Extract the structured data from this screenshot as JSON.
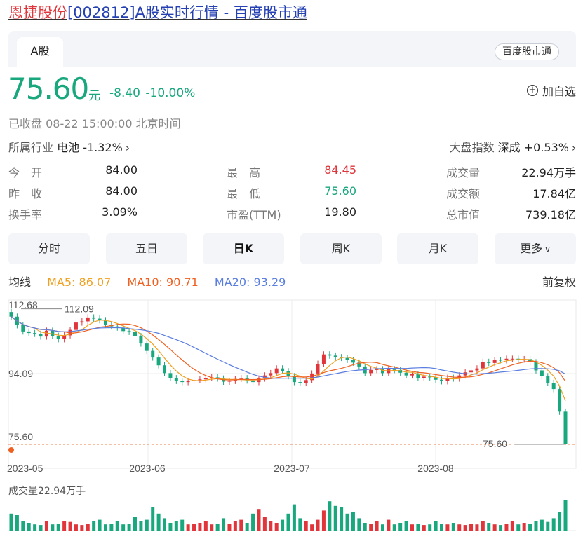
{
  "header": {
    "title_name": "恩捷股份",
    "title_rest": "[002812]A股实时行情 - 百度股市通"
  },
  "tabs": {
    "active": "A股",
    "source_badge": "百度股市通"
  },
  "quote": {
    "price": "75.60",
    "currency": "元",
    "change": "-8.40 -10.00%",
    "add_watch": "加自选",
    "status": "已收盘  08-22 15:00:00  北京时间"
  },
  "industry": {
    "label": "所属行业",
    "value": "电池 -1.32%"
  },
  "market": {
    "label": "大盘指数",
    "value": "深成 +0.53%"
  },
  "stats": {
    "open_label": "今　开",
    "open": "84.00",
    "prev_label": "昨　收",
    "prev": "84.00",
    "turnover_label": "换手率",
    "turnover": "3.09%",
    "high_label": "最　高",
    "high": "84.45",
    "low_label": "最　低",
    "low": "75.60",
    "pe_label": "市盈(TTM)",
    "pe": "19.80",
    "vol_label": "成交量",
    "vol": "22.94万手",
    "amount_label": "成交额",
    "amount": "17.84亿",
    "mcap_label": "总市值",
    "mcap": "739.18亿"
  },
  "period_tabs": [
    "分时",
    "五日",
    "日K",
    "周K",
    "月K",
    "更多"
  ],
  "active_period": "日K",
  "ma": {
    "label": "均线",
    "ma5": "MA5: 86.07",
    "ma10": "MA10: 90.71",
    "ma20": "MA20: 93.29",
    "adjust": "前复权"
  },
  "colors": {
    "up": "#e0353a",
    "down": "#19a77e",
    "ma5": "#f0a020",
    "ma10": "#f06020",
    "ma20": "#5a7ee0"
  },
  "chart_data": {
    "type": "candlestick",
    "y_labels": [
      "112.68",
      "94.09",
      "75.60"
    ],
    "x_labels": [
      "2023-05",
      "2023-06",
      "2023-07",
      "2023-08"
    ],
    "annotations": {
      "max": "112.09",
      "min": "75.60"
    },
    "ylim": [
      75.6,
      112.68
    ],
    "volume_label": "成交量22.94万手",
    "closes": [
      108.4,
      106.2,
      104.6,
      104.2,
      104.0,
      103.3,
      104.8,
      103.5,
      102.6,
      103.6,
      105.0,
      106.9,
      107.2,
      108.2,
      107.9,
      107.5,
      106.3,
      105.9,
      105.6,
      104.7,
      104.5,
      103.4,
      101.5,
      99.6,
      97.9,
      95.9,
      93.9,
      92.6,
      91.9,
      91.6,
      91.9,
      92.1,
      92.3,
      92.6,
      92.8,
      92.5,
      91.7,
      91.9,
      92.4,
      92.6,
      92.0,
      91.6,
      92.5,
      93.3,
      93.9,
      95.1,
      94.4,
      93.1,
      91.6,
      91.4,
      92.1,
      93.8,
      96.3,
      98.7,
      98.4,
      98.0,
      97.8,
      97.3,
      96.6,
      95.6,
      93.9,
      94.7,
      94.9,
      93.9,
      94.9,
      94.7,
      94.0,
      93.3,
      93.7,
      92.6,
      93.0,
      92.8,
      92.2,
      91.8,
      92.7,
      92.5,
      93.3,
      94.1,
      94.6,
      95.1,
      96.8,
      96.5,
      97.3,
      97.2,
      97.6,
      97.6,
      97.4,
      97.5,
      96.7,
      94.6,
      93.1,
      91.4,
      89.8,
      84.0,
      75.6
    ],
    "volumes": [
      0.55,
      0.5,
      0.3,
      0.25,
      0.2,
      0.18,
      0.3,
      0.2,
      0.22,
      0.3,
      0.28,
      0.2,
      0.18,
      0.22,
      0.3,
      0.35,
      0.2,
      0.22,
      0.3,
      0.2,
      0.22,
      0.45,
      0.3,
      0.35,
      0.75,
      0.55,
      0.4,
      0.25,
      0.3,
      0.35,
      0.2,
      0.22,
      0.25,
      0.3,
      0.2,
      0.22,
      0.4,
      0.22,
      0.3,
      0.35,
      0.25,
      0.55,
      0.7,
      0.45,
      0.3,
      0.25,
      0.35,
      0.55,
      0.85,
      0.4,
      0.3,
      0.2,
      0.35,
      0.65,
      0.95,
      0.8,
      0.75,
      0.55,
      0.6,
      0.4,
      0.25,
      0.22,
      0.3,
      0.2,
      0.35,
      0.2,
      0.25,
      0.3,
      0.2,
      0.22,
      0.18,
      0.2,
      0.3,
      0.22,
      0.2,
      0.25,
      0.2,
      0.18,
      0.22,
      0.2,
      0.3,
      0.25,
      0.2,
      0.18,
      0.22,
      0.3,
      0.2,
      0.25,
      0.22,
      0.3,
      0.35,
      0.28,
      0.4,
      0.6,
      1.0
    ]
  }
}
